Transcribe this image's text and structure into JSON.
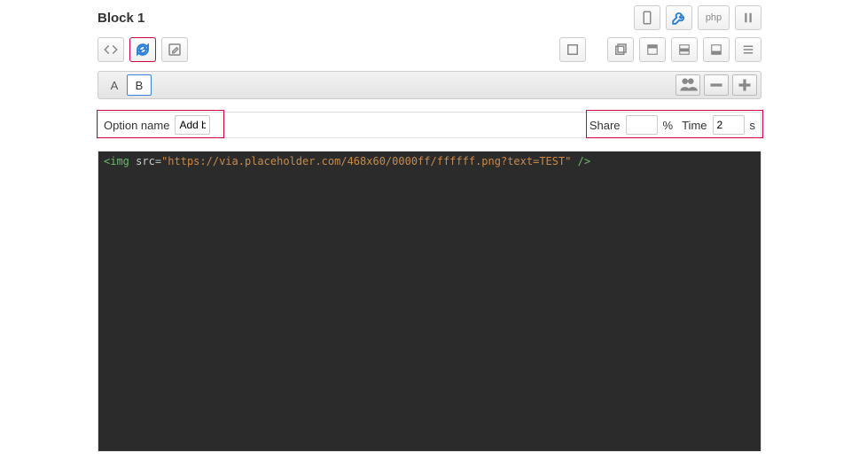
{
  "header": {
    "title": "Block 1",
    "php_label": "php"
  },
  "tabs": {
    "a": "A",
    "b": "B"
  },
  "option": {
    "name_label": "Option name",
    "name_value": "Add b",
    "share_label": "Share",
    "share_value": "",
    "share_unit": "%",
    "time_label": "Time",
    "time_value": "2",
    "time_unit": "s"
  },
  "code": {
    "tag_open": "<img",
    "attr": "src",
    "eq": "=",
    "value": "\"https://via.placeholder.com/468x60/0000ff/ffffff.png?text=TEST\"",
    "close": "/>"
  }
}
